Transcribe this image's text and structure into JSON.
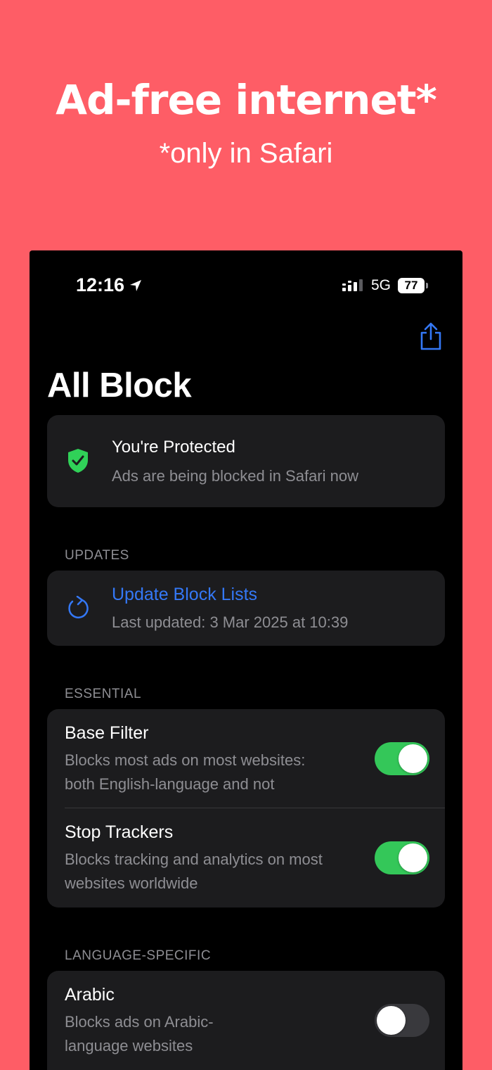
{
  "promo": {
    "headline": "Ad-free internet*",
    "subline": "*only in Safari"
  },
  "status_bar": {
    "time": "12:16",
    "network": "5G",
    "battery": "77"
  },
  "page": {
    "title": "All Block"
  },
  "protection": {
    "title": "You're Protected",
    "subtitle": "Ads are being blocked in Safari now"
  },
  "updates": {
    "section_label": "UPDATES",
    "action_label": "Update Block Lists",
    "last_updated": "Last updated: 3 Mar 2025 at 10:39"
  },
  "essential": {
    "section_label": "ESSENTIAL",
    "items": [
      {
        "title": "Base Filter",
        "desc_line1": "Blocks most ads on most websites:",
        "desc_line2": "both English-language and not",
        "enabled": true
      },
      {
        "title": "Stop Trackers",
        "desc_line1": "Blocks tracking and analytics on most",
        "desc_line2": "websites worldwide",
        "enabled": true
      }
    ]
  },
  "language_specific": {
    "section_label": "LANGUAGE-SPECIFIC",
    "items": [
      {
        "title": "Arabic",
        "desc_line1": "Blocks ads on Arabic-",
        "desc_line2": "language websites",
        "enabled": false
      }
    ]
  },
  "colors": {
    "background": "#fe5d66",
    "accent": "#3478f6",
    "toggle_on": "#34c759",
    "shield": "#30d158"
  }
}
